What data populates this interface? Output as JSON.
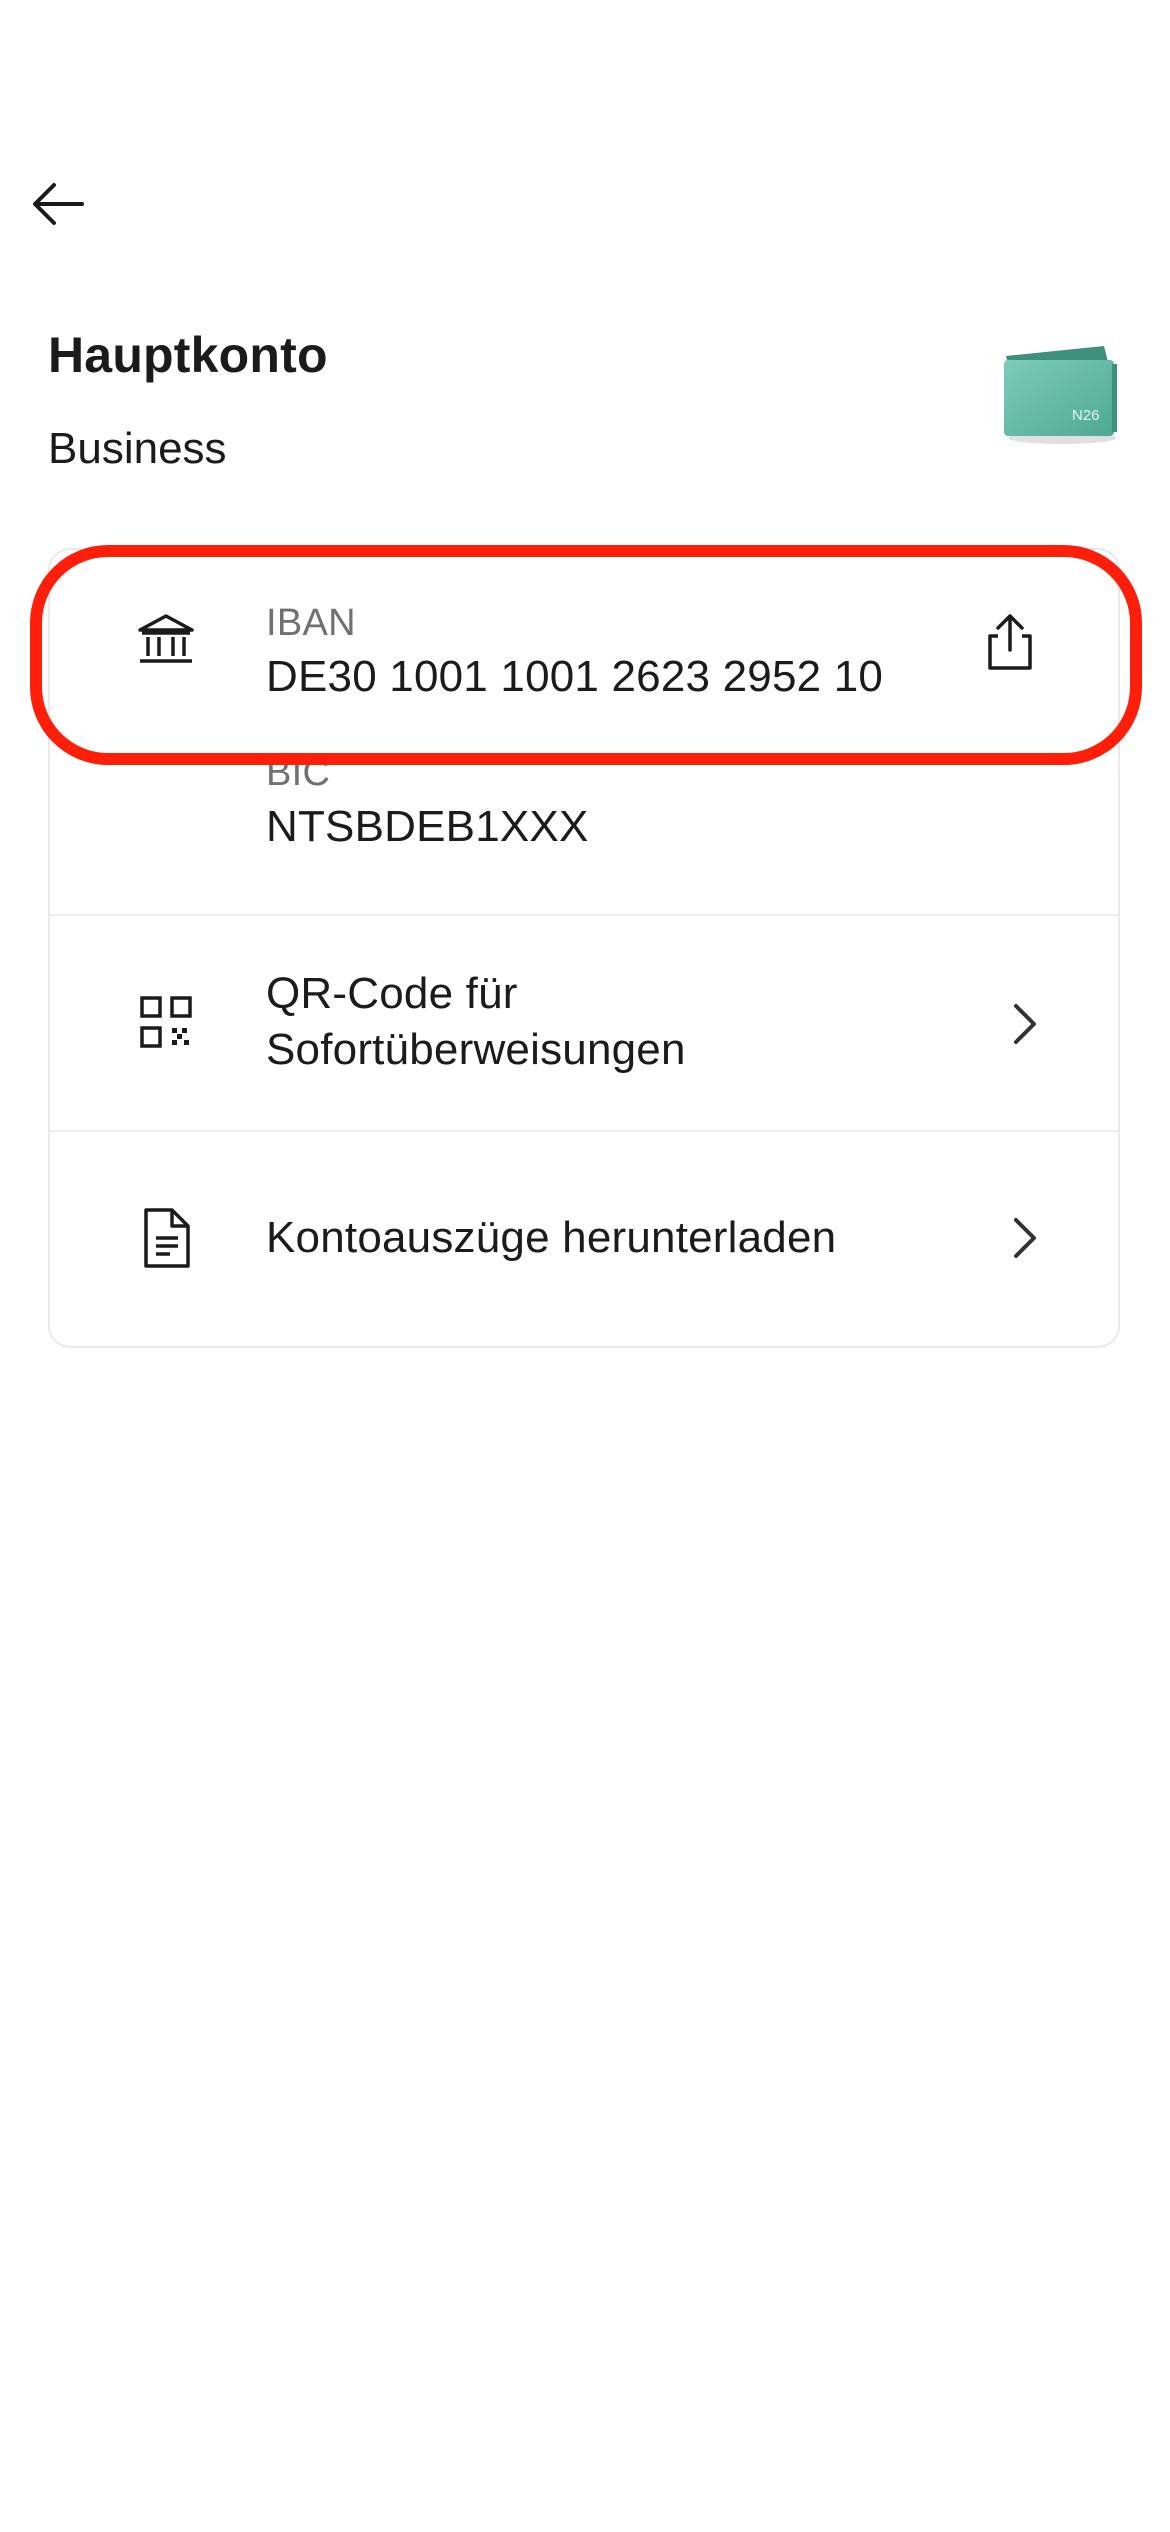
{
  "header": {
    "back_icon": "arrow-left-icon",
    "title": "Hauptkonto",
    "subtitle": "Business",
    "wallet_brand": "N26",
    "wallet_color": "#5fb7a4"
  },
  "details": {
    "iban": {
      "label": "IBAN",
      "value": "DE30 1001 1001 2623 2952 10",
      "icon": "bank-icon",
      "action_icon": "share-icon"
    },
    "bic": {
      "label": "BIC",
      "value": "NTSBDEB1XXX"
    },
    "qr": {
      "line1": "QR-Code für",
      "line2": "Sofortüberweisungen",
      "icon": "qr-code-icon"
    },
    "statements": {
      "label": "Kontoauszüge herunterladen",
      "icon": "document-icon"
    }
  },
  "colors": {
    "highlight": "#ff1e0a",
    "label_gray": "#707070",
    "text": "#1b1b1b"
  }
}
